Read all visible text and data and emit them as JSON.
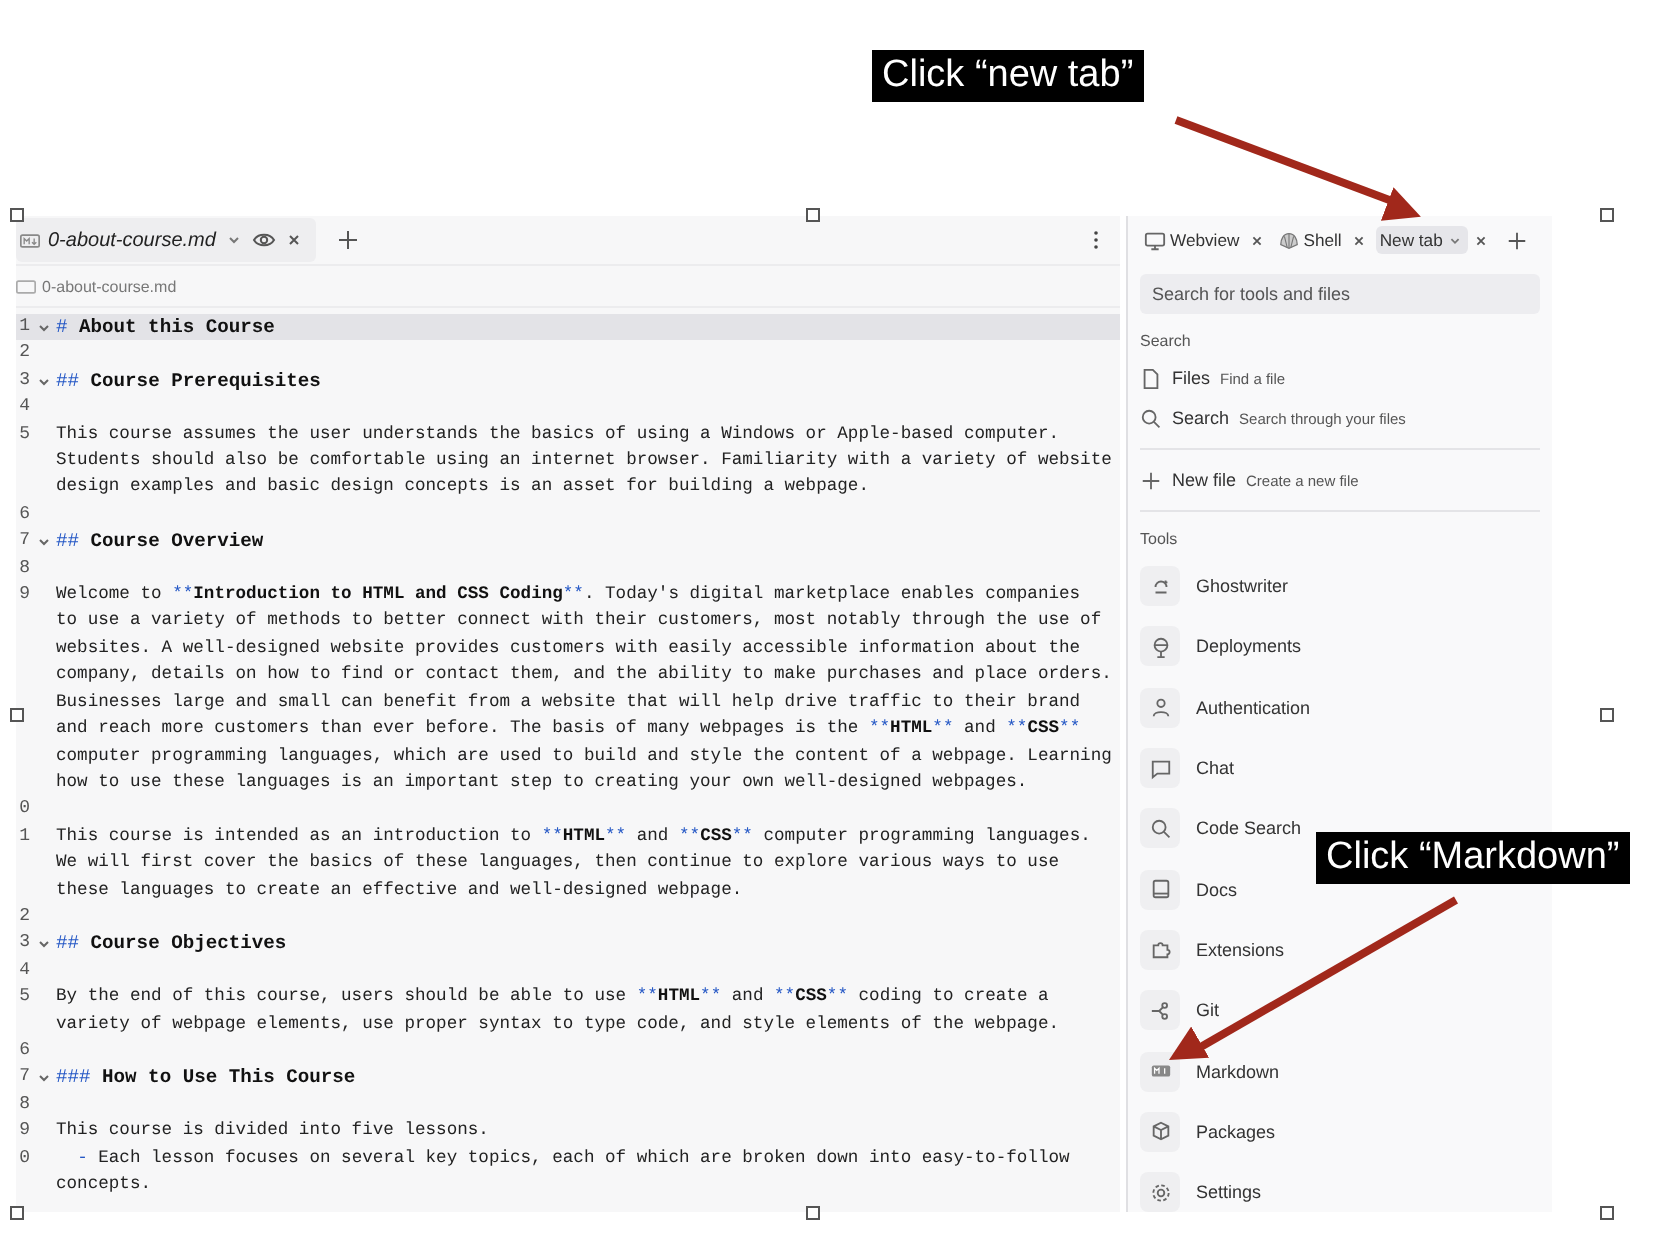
{
  "callouts": [
    {
      "text": "Click “new tab”"
    },
    {
      "text": "Click “Markdown”"
    }
  ],
  "editor": {
    "tab": {
      "label": "0-about-course.md"
    },
    "breadcrumb": "0-about-course.md",
    "lines": [
      {
        "number": "1",
        "foldable": true,
        "active": true,
        "segments": [
          {
            "kind": "mark",
            "text": "# "
          },
          {
            "kind": "bold",
            "text": "About this Course"
          }
        ]
      },
      {
        "number": "2",
        "foldable": false,
        "active": false
      },
      {
        "number": "3",
        "foldable": true,
        "active": false,
        "segments": [
          {
            "kind": "mark",
            "text": "## "
          },
          {
            "kind": "bold",
            "text": "Course Prerequisites"
          }
        ]
      },
      {
        "number": "4",
        "foldable": false,
        "active": false
      },
      {
        "number": "5",
        "foldable": false,
        "active": false,
        "segments": [
          {
            "kind": "text",
            "text": "This course assumes the user understands the basics of using a Windows or Apple-based computer. Students should also be comfortable using an internet browser. Familiarity with a variety of website design examples and basic design concepts is an asset for building a webpage."
          }
        ]
      },
      {
        "number": "6",
        "foldable": false,
        "active": false
      },
      {
        "number": "7",
        "foldable": true,
        "active": false,
        "segments": [
          {
            "kind": "mark",
            "text": "## "
          },
          {
            "kind": "bold",
            "text": "Course Overview"
          }
        ]
      },
      {
        "number": "8",
        "foldable": false,
        "active": false
      },
      {
        "number": "9",
        "foldable": false,
        "active": false,
        "segments": [
          {
            "kind": "text",
            "text": "Welcome to "
          },
          {
            "kind": "mark",
            "text": "**"
          },
          {
            "kind": "bold",
            "text": "Introduction to HTML and CSS Coding"
          },
          {
            "kind": "mark",
            "text": "**"
          },
          {
            "kind": "text",
            "text": ". Today's digital marketplace enables companies to use a variety of methods to better connect with their customers, most notably through the use of websites. A well-designed website provides customers with easily accessible information about the company, details on how to find or contact them, and the ability to make purchases and place orders. Businesses large and small can benefit from a website that will help drive traffic to their brand and reach more customers than ever before. The basis of many webpages is the "
          },
          {
            "kind": "mark",
            "text": "**"
          },
          {
            "kind": "bold",
            "text": "HTML"
          },
          {
            "kind": "mark",
            "text": "**"
          },
          {
            "kind": "text",
            "text": " and "
          },
          {
            "kind": "mark",
            "text": "**"
          },
          {
            "kind": "bold",
            "text": "CSS"
          },
          {
            "kind": "mark",
            "text": "**"
          },
          {
            "kind": "text",
            "text": " computer programming languages, which are used to build and style the content of a webpage. Learning how to use these languages is an important step to creating your own well-designed webpages."
          }
        ]
      },
      {
        "number": "0",
        "foldable": false,
        "active": false
      },
      {
        "number": "1",
        "foldable": false,
        "active": false,
        "segments": [
          {
            "kind": "text",
            "text": "This course is intended as an introduction to "
          },
          {
            "kind": "mark",
            "text": "**"
          },
          {
            "kind": "bold",
            "text": "HTML"
          },
          {
            "kind": "mark",
            "text": "**"
          },
          {
            "kind": "text",
            "text": " and "
          },
          {
            "kind": "mark",
            "text": "**"
          },
          {
            "kind": "bold",
            "text": "CSS"
          },
          {
            "kind": "mark",
            "text": "**"
          },
          {
            "kind": "text",
            "text": " computer programming languages. We will first cover the basics of these languages, then continue to explore various ways to use these languages to create an effective and well-designed webpage."
          }
        ]
      },
      {
        "number": "2",
        "foldable": false,
        "active": false
      },
      {
        "number": "3",
        "foldable": true,
        "active": false,
        "segments": [
          {
            "kind": "mark",
            "text": "## "
          },
          {
            "kind": "bold",
            "text": "Course Objectives"
          }
        ]
      },
      {
        "number": "4",
        "foldable": false,
        "active": false
      },
      {
        "number": "5",
        "foldable": false,
        "active": false,
        "segments": [
          {
            "kind": "text",
            "text": "By the end of this course, users should be able to use "
          },
          {
            "kind": "mark",
            "text": "**"
          },
          {
            "kind": "bold",
            "text": "HTML"
          },
          {
            "kind": "mark",
            "text": "**"
          },
          {
            "kind": "text",
            "text": " and "
          },
          {
            "kind": "mark",
            "text": "**"
          },
          {
            "kind": "bold",
            "text": "CSS"
          },
          {
            "kind": "mark",
            "text": "**"
          },
          {
            "kind": "text",
            "text": " coding to create a variety of webpage elements, use proper syntax to type code, and style elements of the webpage."
          }
        ]
      },
      {
        "number": "6",
        "foldable": false,
        "active": false
      },
      {
        "number": "7",
        "foldable": true,
        "active": false,
        "segments": [
          {
            "kind": "mark",
            "text": "### "
          },
          {
            "kind": "bold",
            "text": "How to Use This Course"
          }
        ]
      },
      {
        "number": "8",
        "foldable": false,
        "active": false
      },
      {
        "number": "9",
        "foldable": false,
        "active": false,
        "segments": [
          {
            "kind": "text",
            "text": "This course is divided into five lessons."
          }
        ]
      },
      {
        "number": "0",
        "foldable": false,
        "active": false,
        "segments": [
          {
            "kind": "mark",
            "text": "  -"
          },
          {
            "kind": "text",
            "text": " Each lesson focuses on several key topics, each of which are broken down into easy-to-follow concepts."
          }
        ]
      }
    ]
  },
  "panel": {
    "tabs": [
      {
        "label": "Webview",
        "selected": false
      },
      {
        "label": "Shell",
        "selected": false
      },
      {
        "label": "New tab",
        "selected": true
      }
    ],
    "search": {
      "placeholder": "Search for tools and files"
    },
    "search_section": {
      "heading": "Search",
      "items": [
        {
          "label": "Files",
          "hint": "Find a file"
        },
        {
          "label": "Search",
          "hint": "Search through your files"
        }
      ]
    },
    "new_file": {
      "label": "New file",
      "hint": "Create a new file"
    },
    "tools_section": {
      "heading": "Tools",
      "items": [
        {
          "label": "Ghostwriter"
        },
        {
          "label": "Deployments"
        },
        {
          "label": "Authentication"
        },
        {
          "label": "Chat"
        },
        {
          "label": "Code Search"
        },
        {
          "label": "Docs"
        },
        {
          "label": "Extensions"
        },
        {
          "label": "Git"
        },
        {
          "label": "Markdown"
        },
        {
          "label": "Packages"
        },
        {
          "label": "Settings"
        }
      ]
    }
  }
}
